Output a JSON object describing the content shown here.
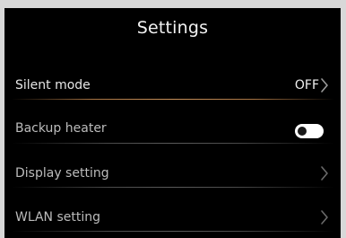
{
  "header": {
    "title": "Settings"
  },
  "settings": {
    "silent_mode": {
      "label": "Silent mode",
      "value": "OFF"
    },
    "backup_heater": {
      "label": "Backup heater",
      "enabled": false
    },
    "display_setting": {
      "label": "Display setting"
    },
    "wlan_setting": {
      "label": "WLAN setting"
    }
  },
  "colors": {
    "background": "#000000",
    "text": "#e6e6e6",
    "active_divider": "#c9915a",
    "divider": "#4a4a4a",
    "toggle_track": "#ffffff",
    "toggle_knob": "#1a1a1a"
  },
  "icons": {
    "row_arrow": "chevron-right-icon"
  }
}
